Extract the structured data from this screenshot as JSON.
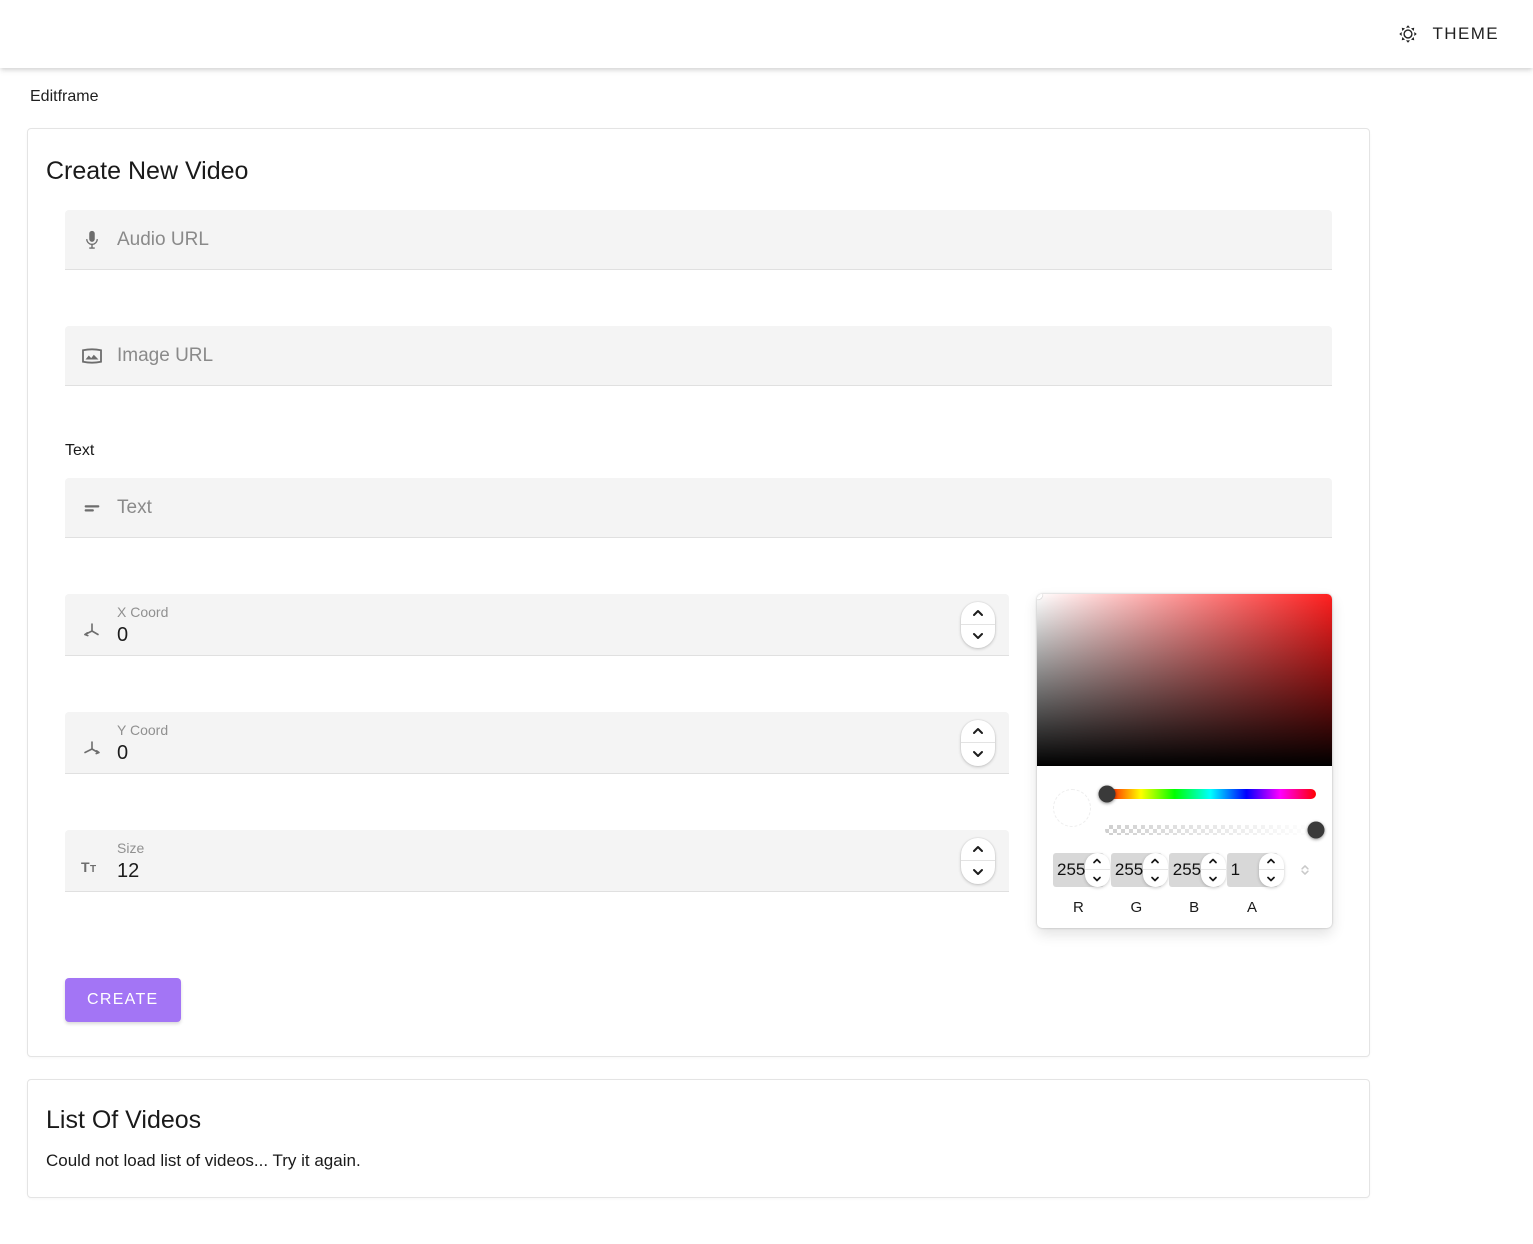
{
  "appbar": {
    "theme_label": "THEME",
    "theme_icon": "brightness-sun-icon"
  },
  "breadcrumb": "Editframe",
  "create_card": {
    "title": "Create New Video",
    "fields": {
      "audio_url": {
        "placeholder": "Audio URL",
        "icon": "microphone-icon"
      },
      "image_url": {
        "placeholder": "Image URL",
        "icon": "image-panorama-icon"
      },
      "text_section_label": "Text",
      "text": {
        "placeholder": "Text",
        "icon": "short-text-icon"
      },
      "x_coord": {
        "label": "X Coord",
        "value": "0",
        "icon": "axis-x-icon"
      },
      "y_coord": {
        "label": "Y Coord",
        "value": "0",
        "icon": "axis-y-icon"
      },
      "size": {
        "label": "Size",
        "value": "12",
        "icon": "format-size-icon"
      }
    },
    "color_picker": {
      "hue": 0,
      "saturation": 0,
      "value": 100,
      "channels": [
        {
          "caption": "R",
          "value": "255"
        },
        {
          "caption": "G",
          "value": "255"
        },
        {
          "caption": "B",
          "value": "255"
        },
        {
          "caption": "A",
          "value": "1"
        }
      ],
      "swatch_color": "#ffffff",
      "unit_toggle_icon": "unfold-more-icon"
    },
    "submit_label": "CREATE",
    "submit_color": "#a375f5"
  },
  "list_card": {
    "title": "List Of Videos",
    "message": "Could not load list of videos... Try it again."
  }
}
